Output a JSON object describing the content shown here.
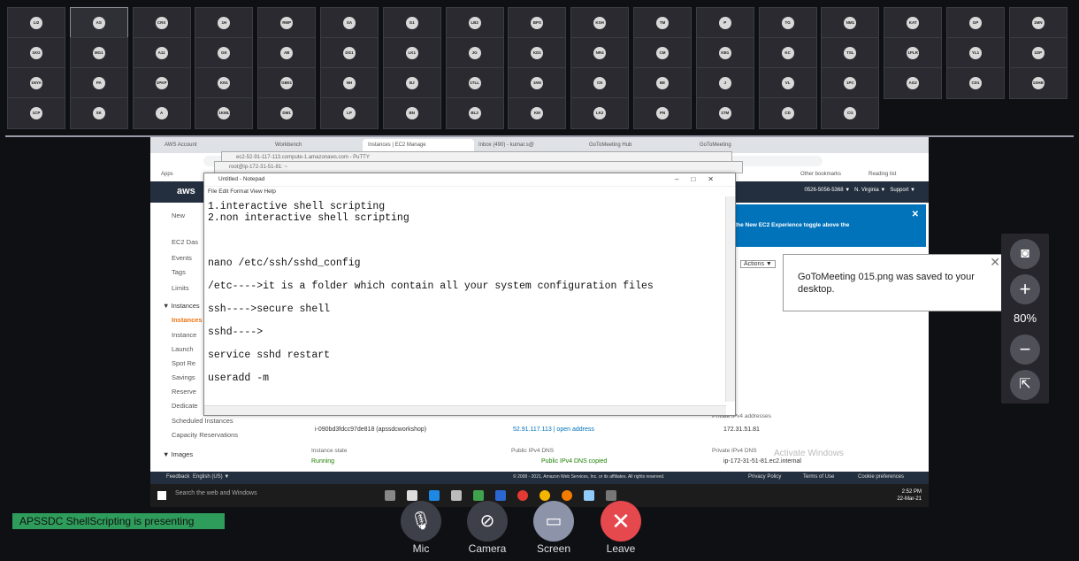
{
  "participants_row1": [
    "LI2",
    "AS",
    "CRX",
    "1H",
    "RMP",
    "SA",
    "G1",
    "LB2",
    "BPS",
    "KSH",
    "TM",
    "P",
    "TG",
    "NM1",
    "KAT",
    "GP",
    "1MN"
  ],
  "participants_row2": [
    "1KG",
    "MG1",
    "A11",
    "GK",
    "AB",
    "DG1",
    "LK1",
    "JG",
    "KD1",
    "NR4",
    "CM",
    "KB1",
    "KC",
    "TSL",
    "1PLR",
    "YL1",
    "1DP"
  ],
  "participants_row3": [
    "1NYA",
    "PA",
    "1PKP",
    "KN1",
    "GB01",
    "NH",
    "BJ",
    "1TLL",
    "1NN",
    "CN",
    "BE",
    "J",
    "VL",
    "1PC",
    "AG2",
    "CD1",
    "1SHB"
  ],
  "participants_row4": [
    "1CP",
    "SK",
    "A",
    "1KML",
    "DM1",
    "LP",
    "BN",
    "BL2",
    "KM",
    "LK2",
    "PN",
    "1TM",
    "CD",
    "CG"
  ],
  "browser": {
    "tabs": [
      "AWS Account",
      "Workbench",
      "Instances | EC2 Manage",
      "Inbox (490) - kumar.s@",
      "GoToMeeting Hub",
      "GoToMeeting"
    ],
    "apps_label": "Apps",
    "other_bookmarks": "Other bookmarks",
    "reading_list": "Reading list",
    "back_window_1": "ec2-52-91-117-113.compute-1.amazonaws.com - PuTTY",
    "back_window_2": "root@ip-172-31-51-81: ~"
  },
  "aws": {
    "logo": "aws",
    "account": "0526-5056-5368 ▼",
    "region": "N. Virginia ▼",
    "support": "Support ▼",
    "banner": "the New EC2 Experience toggle above the",
    "actions": "Actions ▼",
    "sidenav": [
      "New",
      "EC2 Das",
      "Events",
      "Tags",
      "Limits",
      "▼ Instances",
      "Instances",
      "Instance",
      "Launch",
      "Spot Re",
      "Savings",
      "Reserve",
      "Dedicate",
      "Scheduled Instances",
      "Capacity Reservations",
      "▼ Images"
    ],
    "instance_id": "i-090bd3fdcc97de818 (apssdcworkshop)",
    "public_ip": "52.91.117.113 | open address",
    "private_ip_label": "Private IPv4 addresses",
    "private_ip": "172.31.51.81",
    "instance_state_label": "Instance state",
    "instance_state": "Running",
    "public_dns_label": "Public IPv4 DNS",
    "public_dns": "Public IPv4 DNS copied",
    "private_dns_label": "Private IPv4 DNS",
    "private_dns": "ip-172-31-51-81.ec2.internal",
    "watermark": "Activate Windows",
    "footer_feedback": "Feedback",
    "footer_lang": "English (US) ▼",
    "footer_copy": "© 2008 - 2021, Amazon Web Services, Inc. or its affiliates. All rights reserved.",
    "footer_privacy": "Privacy Policy",
    "footer_terms": "Terms of Use",
    "footer_cookie": "Cookie preferences"
  },
  "windows": {
    "search": "Search the web and Windows",
    "time": "2:52 PM",
    "date": "22-Mar-21"
  },
  "notepad": {
    "title": "Untitled - Notepad",
    "menu": "File  Edit  Format  View  Help",
    "lines": [
      "1.interactive shell scripting",
      "2.non interactive shell scripting",
      "nano /etc/ssh/sshd_config",
      "/etc---->it is a folder which contain all your system configuration files",
      "ssh---->secure shell",
      "sshd---->",
      "service sshd restart",
      "useradd -m"
    ]
  },
  "toast": {
    "message": "GoToMeeting 015.png was saved to your desktop."
  },
  "rightbar": {
    "zoom": "80%"
  },
  "presenting": "APSSDC ShellScripting is presenting",
  "controls": {
    "mic": "Mic",
    "camera": "Camera",
    "screen": "Screen",
    "leave": "Leave"
  },
  "colors": {
    "leave": "#e5484d",
    "presenting": "#2e9d5b",
    "aws_bar": "#232f3e",
    "banner": "#0073bb"
  }
}
